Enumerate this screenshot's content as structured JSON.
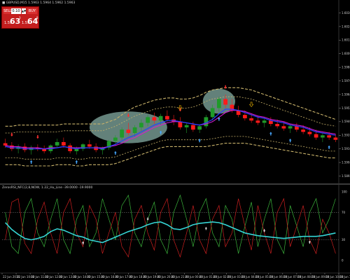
{
  "window": {
    "main_title": "■ GBPUSD,M15  1.5963 1.5964 1.5962 1.5963",
    "osc_title": "ZerosRSI_NFC(2,8,NOW,  1.22_Hu_Line  -39.0000  -19.9000"
  },
  "trade_panel": {
    "sell_label": "SELL",
    "buy_label": "BUY",
    "lot_value": "0.10",
    "spin_glyph": "▲▼",
    "bid_prefix": "1.59",
    "bid_big": "63",
    "bid_sup": "3",
    "ask_prefix": "1.59",
    "ask_big": "64",
    "ask_sup": "8"
  },
  "price_axis": [
    "1.6036",
    "1.6024",
    "1.6012",
    "1.6000",
    "1.5988",
    "1.5976",
    "1.5964",
    "1.5952",
    "1.5940",
    "1.5928",
    "1.5916",
    "1.5904",
    "1.5892"
  ],
  "osc_axis": [
    "100",
    "70",
    "30",
    "0"
  ],
  "time_axis": [
    "22 Jun 2016",
    "22 Jun 10:00",
    "22 Jun 11:00",
    "22 Jun 12:00",
    "22 Jun 13:00",
    "22 Jun 14:00",
    "22 Jun 15:00",
    "22 Jun 16:00",
    "22 Jun 17:00",
    "22 Jun 18:00",
    "22 Jun 19:00",
    "22 Jun 20:00",
    "22 Jun 21:00",
    "23 Jun 00:00",
    "23 Jun 01:00",
    "23 Jun 02:00",
    "23 Jun 03:00",
    "23 Jun 04:00",
    "23 Jun 05:00",
    "23 Jun 06:00",
    "23 Jun 07:00",
    "23 Jun 08:00",
    "23 Jun 09:00",
    "23 Jun 10:00",
    "23 Jun 11:00"
  ],
  "colors": {
    "bull": "#1f9a2a",
    "bear": "#ff1a1a",
    "ma_blue": "#2a3cff",
    "ma_magenta": "#d21ad2",
    "band": "#c8b26a",
    "highlight": "#7fa59c",
    "up_arrow": "#47a8ff",
    "down_arrow": "#ff3030",
    "signal_arrow": "#e8b000",
    "rsi_main": "#35d4d4",
    "rsi_green": "#3bb33b",
    "rsi_red": "#cc1f1f"
  },
  "chart_data": [
    {
      "type": "candlestick",
      "title": "GBPUSD,M15",
      "candles": [
        {
          "o": 1.5921,
          "h": 1.5925,
          "l": 1.5917,
          "c": 1.5919
        },
        {
          "o": 1.5919,
          "h": 1.5922,
          "l": 1.5914,
          "c": 1.5916
        },
        {
          "o": 1.5916,
          "h": 1.592,
          "l": 1.5912,
          "c": 1.5918
        },
        {
          "o": 1.5918,
          "h": 1.5921,
          "l": 1.5913,
          "c": 1.5915
        },
        {
          "o": 1.5915,
          "h": 1.5919,
          "l": 1.5911,
          "c": 1.5917
        },
        {
          "o": 1.5917,
          "h": 1.592,
          "l": 1.5914,
          "c": 1.5916
        },
        {
          "o": 1.5916,
          "h": 1.5919,
          "l": 1.5912,
          "c": 1.5914
        },
        {
          "o": 1.5914,
          "h": 1.592,
          "l": 1.5912,
          "c": 1.5919
        },
        {
          "o": 1.5919,
          "h": 1.5925,
          "l": 1.5917,
          "c": 1.5922
        },
        {
          "o": 1.5922,
          "h": 1.5926,
          "l": 1.5917,
          "c": 1.5919
        },
        {
          "o": 1.5919,
          "h": 1.5921,
          "l": 1.5912,
          "c": 1.5914
        },
        {
          "o": 1.5914,
          "h": 1.5918,
          "l": 1.5911,
          "c": 1.5916
        },
        {
          "o": 1.5916,
          "h": 1.5921,
          "l": 1.5914,
          "c": 1.592
        },
        {
          "o": 1.592,
          "h": 1.5924,
          "l": 1.5916,
          "c": 1.5918
        },
        {
          "o": 1.5918,
          "h": 1.5921,
          "l": 1.5913,
          "c": 1.5915
        },
        {
          "o": 1.5915,
          "h": 1.5918,
          "l": 1.5911,
          "c": 1.5917
        },
        {
          "o": 1.5917,
          "h": 1.5924,
          "l": 1.5915,
          "c": 1.5923
        },
        {
          "o": 1.5923,
          "h": 1.5928,
          "l": 1.5919,
          "c": 1.5926
        },
        {
          "o": 1.5926,
          "h": 1.5935,
          "l": 1.5924,
          "c": 1.5933
        },
        {
          "o": 1.5933,
          "h": 1.5939,
          "l": 1.5928,
          "c": 1.593
        },
        {
          "o": 1.593,
          "h": 1.5937,
          "l": 1.5927,
          "c": 1.5935
        },
        {
          "o": 1.5935,
          "h": 1.5942,
          "l": 1.5932,
          "c": 1.5939
        },
        {
          "o": 1.5939,
          "h": 1.5946,
          "l": 1.5936,
          "c": 1.5944
        },
        {
          "o": 1.5944,
          "h": 1.5948,
          "l": 1.5938,
          "c": 1.5941
        },
        {
          "o": 1.5941,
          "h": 1.5947,
          "l": 1.5937,
          "c": 1.5945
        },
        {
          "o": 1.5945,
          "h": 1.595,
          "l": 1.594,
          "c": 1.5942
        },
        {
          "o": 1.5942,
          "h": 1.5946,
          "l": 1.5937,
          "c": 1.594
        },
        {
          "o": 1.594,
          "h": 1.5944,
          "l": 1.5933,
          "c": 1.5935
        },
        {
          "o": 1.5935,
          "h": 1.5939,
          "l": 1.593,
          "c": 1.5937
        },
        {
          "o": 1.5937,
          "h": 1.594,
          "l": 1.5931,
          "c": 1.5933
        },
        {
          "o": 1.5933,
          "h": 1.5938,
          "l": 1.593,
          "c": 1.5936
        },
        {
          "o": 1.5936,
          "h": 1.5946,
          "l": 1.5934,
          "c": 1.5944
        },
        {
          "o": 1.5944,
          "h": 1.5955,
          "l": 1.5941,
          "c": 1.5952
        },
        {
          "o": 1.5952,
          "h": 1.5962,
          "l": 1.5949,
          "c": 1.596
        },
        {
          "o": 1.596,
          "h": 1.5964,
          "l": 1.5952,
          "c": 1.5955
        },
        {
          "o": 1.5955,
          "h": 1.596,
          "l": 1.5948,
          "c": 1.595
        },
        {
          "o": 1.595,
          "h": 1.5954,
          "l": 1.5944,
          "c": 1.5946
        },
        {
          "o": 1.5946,
          "h": 1.595,
          "l": 1.5941,
          "c": 1.5943
        },
        {
          "o": 1.5943,
          "h": 1.5947,
          "l": 1.5939,
          "c": 1.5941
        },
        {
          "o": 1.5941,
          "h": 1.5945,
          "l": 1.5937,
          "c": 1.5939
        },
        {
          "o": 1.5939,
          "h": 1.5943,
          "l": 1.5935,
          "c": 1.5941
        },
        {
          "o": 1.5941,
          "h": 1.5944,
          "l": 1.5936,
          "c": 1.5938
        },
        {
          "o": 1.5938,
          "h": 1.5942,
          "l": 1.5934,
          "c": 1.5936
        },
        {
          "o": 1.5936,
          "h": 1.594,
          "l": 1.5932,
          "c": 1.5934
        },
        {
          "o": 1.5934,
          "h": 1.5938,
          "l": 1.593,
          "c": 1.5936
        },
        {
          "o": 1.5936,
          "h": 1.5939,
          "l": 1.5931,
          "c": 1.5933
        },
        {
          "o": 1.5933,
          "h": 1.5937,
          "l": 1.5929,
          "c": 1.5931
        },
        {
          "o": 1.5931,
          "h": 1.5935,
          "l": 1.5927,
          "c": 1.5929
        },
        {
          "o": 1.5929,
          "h": 1.5933,
          "l": 1.5924,
          "c": 1.5926
        },
        {
          "o": 1.5926,
          "h": 1.593,
          "l": 1.5922,
          "c": 1.5928
        },
        {
          "o": 1.5928,
          "h": 1.5931,
          "l": 1.5924,
          "c": 1.5926
        },
        {
          "o": 1.5926,
          "h": 1.5929,
          "l": 1.5922,
          "c": 1.5924
        }
      ],
      "ma_blue": [
        1.5918,
        1.5917,
        1.5917,
        1.5916,
        1.5916,
        1.5916,
        1.5916,
        1.5916,
        1.5917,
        1.5918,
        1.5917,
        1.5916,
        1.5917,
        1.5917,
        1.5917,
        1.5916,
        1.5918,
        1.592,
        1.5923,
        1.5926,
        1.5928,
        1.5931,
        1.5934,
        1.5937,
        1.5939,
        1.5941,
        1.5941,
        1.594,
        1.5939,
        1.5938,
        1.5937,
        1.5939,
        1.5942,
        1.5947,
        1.5951,
        1.5951,
        1.595,
        1.5948,
        1.5946,
        1.5944,
        1.5943,
        1.5941,
        1.594,
        1.5939,
        1.5937,
        1.5936,
        1.5935,
        1.5933,
        1.5931,
        1.593,
        1.5929,
        1.5928
      ],
      "ma_magenta": [
        1.5919,
        1.5918,
        1.5918,
        1.5917,
        1.5917,
        1.5917,
        1.5916,
        1.5917,
        1.5917,
        1.5918,
        1.5917,
        1.5917,
        1.5917,
        1.5917,
        1.5917,
        1.5917,
        1.5918,
        1.5919,
        1.5921,
        1.5924,
        1.5926,
        1.5929,
        1.5932,
        1.5935,
        1.5937,
        1.5939,
        1.594,
        1.594,
        1.5939,
        1.5938,
        1.5937,
        1.5938,
        1.594,
        1.5944,
        1.5948,
        1.595,
        1.595,
        1.5949,
        1.5947,
        1.5945,
        1.5944,
        1.5942,
        1.5941,
        1.594,
        1.5938,
        1.5937,
        1.5936,
        1.5934,
        1.5932,
        1.5931,
        1.593,
        1.5929
      ],
      "band_outer_upper": [
        1.5936,
        1.5936,
        1.5937,
        1.5937,
        1.5937,
        1.5937,
        1.5937,
        1.5937,
        1.5937,
        1.5938,
        1.5938,
        1.5938,
        1.5938,
        1.5938,
        1.5938,
        1.5938,
        1.594,
        1.5942,
        1.5946,
        1.595,
        1.5953,
        1.5955,
        1.5957,
        1.5959,
        1.596,
        1.5961,
        1.5961,
        1.596,
        1.596,
        1.5961,
        1.5963,
        1.5966,
        1.5968,
        1.5969,
        1.597,
        1.597,
        1.597,
        1.5969,
        1.5968,
        1.5966,
        1.5964,
        1.5962,
        1.596,
        1.5958,
        1.5956,
        1.5954,
        1.5952,
        1.595,
        1.5948,
        1.5946,
        1.5944,
        1.5942
      ],
      "band_inner_upper": [
        1.593,
        1.593,
        1.5931,
        1.5931,
        1.5931,
        1.5931,
        1.5931,
        1.5931,
        1.5931,
        1.5932,
        1.5932,
        1.5932,
        1.5932,
        1.5932,
        1.5932,
        1.5932,
        1.5934,
        1.5936,
        1.5939,
        1.5942,
        1.5945,
        1.5947,
        1.5949,
        1.5951,
        1.5952,
        1.5953,
        1.5953,
        1.5952,
        1.5952,
        1.5953,
        1.5955,
        1.5958,
        1.596,
        1.5961,
        1.5962,
        1.5962,
        1.5962,
        1.5961,
        1.596,
        1.5958,
        1.5956,
        1.5954,
        1.5952,
        1.595,
        1.5948,
        1.5946,
        1.5944,
        1.5942,
        1.594,
        1.5938,
        1.5937,
        1.5936
      ],
      "band_inner_lower": [
        1.5908,
        1.5908,
        1.5908,
        1.5907,
        1.5907,
        1.5907,
        1.5907,
        1.5907,
        1.5908,
        1.5908,
        1.5908,
        1.5907,
        1.5907,
        1.5908,
        1.5908,
        1.5908,
        1.5908,
        1.5909,
        1.5911,
        1.5913,
        1.5915,
        1.5917,
        1.5919,
        1.5921,
        1.5923,
        1.5924,
        1.5924,
        1.5924,
        1.5924,
        1.5924,
        1.5924,
        1.5924,
        1.5925,
        1.5926,
        1.5927,
        1.5927,
        1.5927,
        1.5927,
        1.5926,
        1.5925,
        1.5924,
        1.5923,
        1.5922,
        1.5921,
        1.592,
        1.5919,
        1.5918,
        1.5917,
        1.5916,
        1.5915,
        1.5914,
        1.5914
      ],
      "band_outer_lower": [
        1.5902,
        1.5902,
        1.5902,
        1.5901,
        1.5901,
        1.5901,
        1.5901,
        1.5901,
        1.5902,
        1.5902,
        1.5902,
        1.5901,
        1.5901,
        1.5902,
        1.5902,
        1.5902,
        1.5902,
        1.5903,
        1.5905,
        1.5907,
        1.5909,
        1.5911,
        1.5913,
        1.5915,
        1.5917,
        1.5918,
        1.5918,
        1.5918,
        1.5918,
        1.5918,
        1.5918,
        1.5918,
        1.5919,
        1.592,
        1.5921,
        1.5921,
        1.5921,
        1.5921,
        1.592,
        1.5919,
        1.5918,
        1.5917,
        1.5916,
        1.5915,
        1.5914,
        1.5913,
        1.5912,
        1.5911,
        1.591,
        1.5909,
        1.5908,
        1.5908
      ],
      "up_arrow_bars": [
        4,
        11,
        17,
        24,
        30,
        33,
        41,
        44,
        50
      ],
      "down_arrow_bars": [
        1,
        5,
        19,
        27,
        34
      ],
      "signal_arrow_bars": [
        27,
        38
      ],
      "highlight_ellipses": [
        {
          "center_bar": 19,
          "center_price": 1.5935,
          "bar_radius": 6,
          "price_radius": 0.0014
        },
        {
          "center_bar": 33,
          "center_price": 1.5958,
          "bar_radius": 2.5,
          "price_radius": 0.0011
        }
      ],
      "y_range": [
        1.5888,
        1.604
      ]
    },
    {
      "type": "line",
      "title": "ZerosRSI_NFC",
      "y_range": [
        0,
        100
      ],
      "levels": [
        70,
        30
      ],
      "series": [
        {
          "values": [
            55,
            45,
            38,
            32,
            30,
            32,
            35,
            42,
            46,
            44,
            40,
            36,
            34,
            30,
            28,
            26,
            30,
            34,
            38,
            42,
            45,
            48,
            52,
            55,
            56,
            52,
            46,
            45,
            48,
            52,
            54,
            55,
            56,
            55,
            52,
            48,
            44,
            40,
            38,
            36,
            35,
            34,
            33,
            32,
            33,
            34,
            35,
            35,
            35,
            36,
            38,
            40
          ]
        },
        {
          "values": [
            70,
            20,
            10,
            70,
            90,
            40,
            20,
            60,
            90,
            30,
            10,
            60,
            80,
            20,
            40,
            90,
            60,
            30,
            80,
            95,
            40,
            20,
            60,
            85,
            30,
            10,
            70,
            95,
            60,
            20,
            70,
            90,
            40,
            20,
            80,
            60,
            10,
            50,
            85,
            20,
            60,
            90,
            30,
            10,
            80,
            50,
            20,
            70,
            90,
            40,
            60,
            90
          ]
        },
        {
          "values": [
            30,
            85,
            90,
            25,
            10,
            60,
            85,
            40,
            10,
            70,
            90,
            40,
            20,
            80,
            60,
            10,
            40,
            70,
            20,
            5,
            60,
            80,
            40,
            15,
            70,
            90,
            30,
            5,
            40,
            80,
            30,
            10,
            60,
            80,
            20,
            40,
            90,
            50,
            15,
            80,
            40,
            10,
            70,
            90,
            20,
            50,
            80,
            30,
            10,
            60,
            40,
            10
          ]
        }
      ],
      "arrows": [
        {
          "bar": 12,
          "dir": "up"
        },
        {
          "bar": 22,
          "dir": "down"
        },
        {
          "bar": 31,
          "dir": "up"
        },
        {
          "bar": 40,
          "dir": "down"
        },
        {
          "bar": 47,
          "dir": "up"
        }
      ]
    }
  ]
}
